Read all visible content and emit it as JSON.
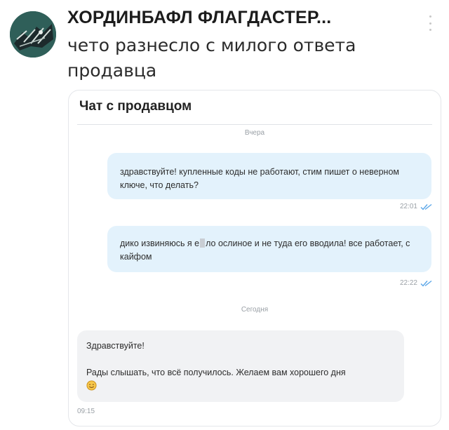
{
  "post": {
    "author": "ХОРДИНБАФЛ ФЛАГДАСТЕР...",
    "text": "чето разнесло с милого ответа продавца",
    "avatar_icon": "avatar-photo",
    "menu_icon": "kebab-menu-icon"
  },
  "chat": {
    "title": "Чат с продавцом",
    "separators": {
      "yesterday": "Вчера",
      "today": "Сегодня"
    },
    "messages": [
      {
        "direction": "outgoing",
        "text": "здравствуйте! купленные коды не работают, стим пишет о неверном ключе, что делать?",
        "time": "22:01",
        "status_icon": "double-check-icon"
      },
      {
        "direction": "outgoing",
        "text_before": "дико извиняюсь я е",
        "text_after": "ло ослиное и не туда его вводила! все работает, с кайфом",
        "time": "22:22",
        "status_icon": "double-check-icon"
      },
      {
        "direction": "incoming",
        "greeting": "Здравствуйте!",
        "text": "Рады слышать, что всё получилось. Желаем вам хорошего дня",
        "emoji": "smiling-face-icon",
        "time": "09:15"
      }
    ],
    "colors": {
      "outgoing_bubble": "#e3f2fc",
      "incoming_bubble": "#f1f2f4",
      "check_color": "#5aa6e8"
    }
  }
}
